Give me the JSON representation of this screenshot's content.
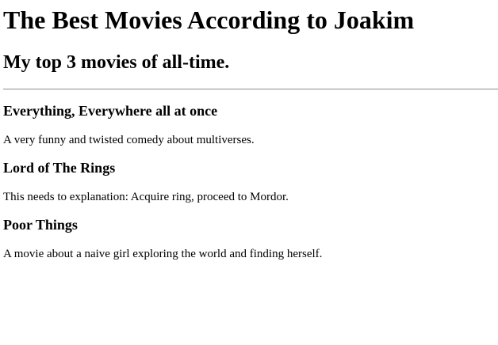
{
  "page": {
    "title": "The Best Movies According to Joakim",
    "subtitle": "My top 3 movies of all-time."
  },
  "movies": [
    {
      "title": "Everything, Everywhere all at once",
      "description": "A very funny and twisted comedy about multiverses."
    },
    {
      "title": "Lord of The Rings",
      "description": "This needs to explanation: Acquire ring, proceed to Mordor."
    },
    {
      "title": "Poor Things",
      "description": "A movie about a naive girl exploring the world and finding herself."
    }
  ]
}
